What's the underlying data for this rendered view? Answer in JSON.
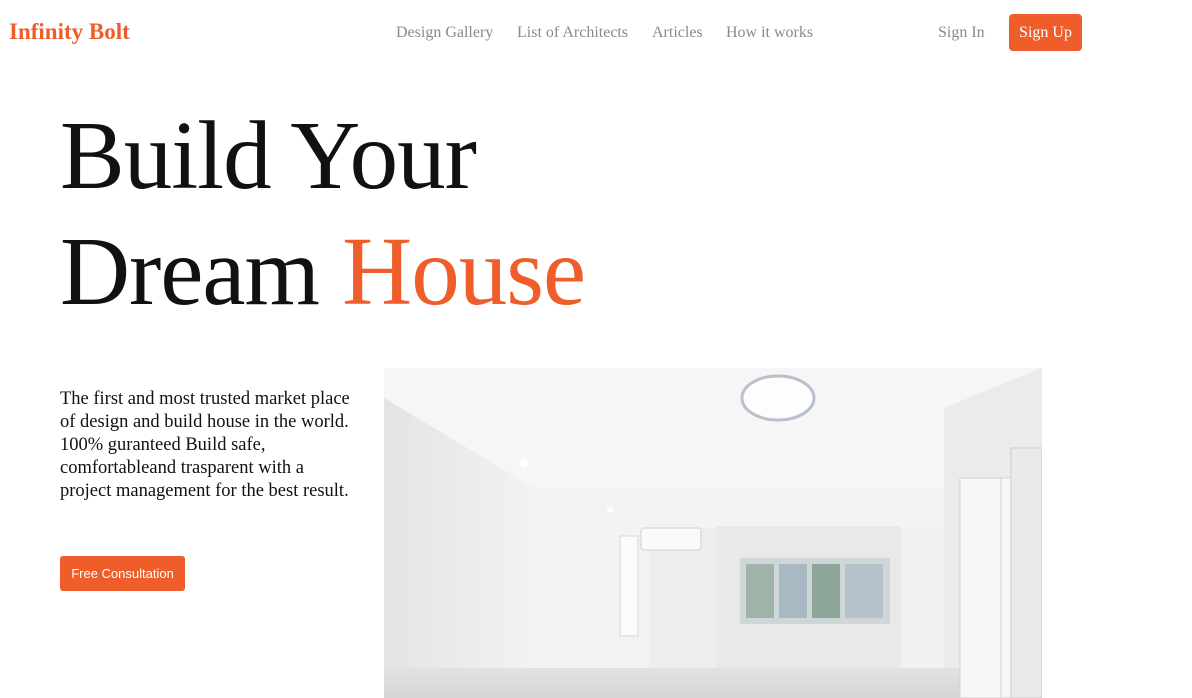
{
  "brand": {
    "name": "Infinity Bolt",
    "color": "#ee5d2a"
  },
  "nav": {
    "links": [
      "Design Gallery",
      "List of Architects",
      "Articles",
      "How it works"
    ],
    "sign_in": "Sign In",
    "sign_up": "Sign Up"
  },
  "hero": {
    "title_line1": "Build Your",
    "title_line2_plain": "Dream",
    "title_line2_accent": "House",
    "description": "The first and most trusted market place of design and build house in the world. 100% guranteed Build safe, comfortableand trasparent with a project management for the best result.",
    "cta": "Free Consultation",
    "image_icon": "interior-room-photo"
  },
  "colors": {
    "accent": "#ee5d2a",
    "nav_text": "#8a8a8a",
    "body_text": "#111111"
  }
}
